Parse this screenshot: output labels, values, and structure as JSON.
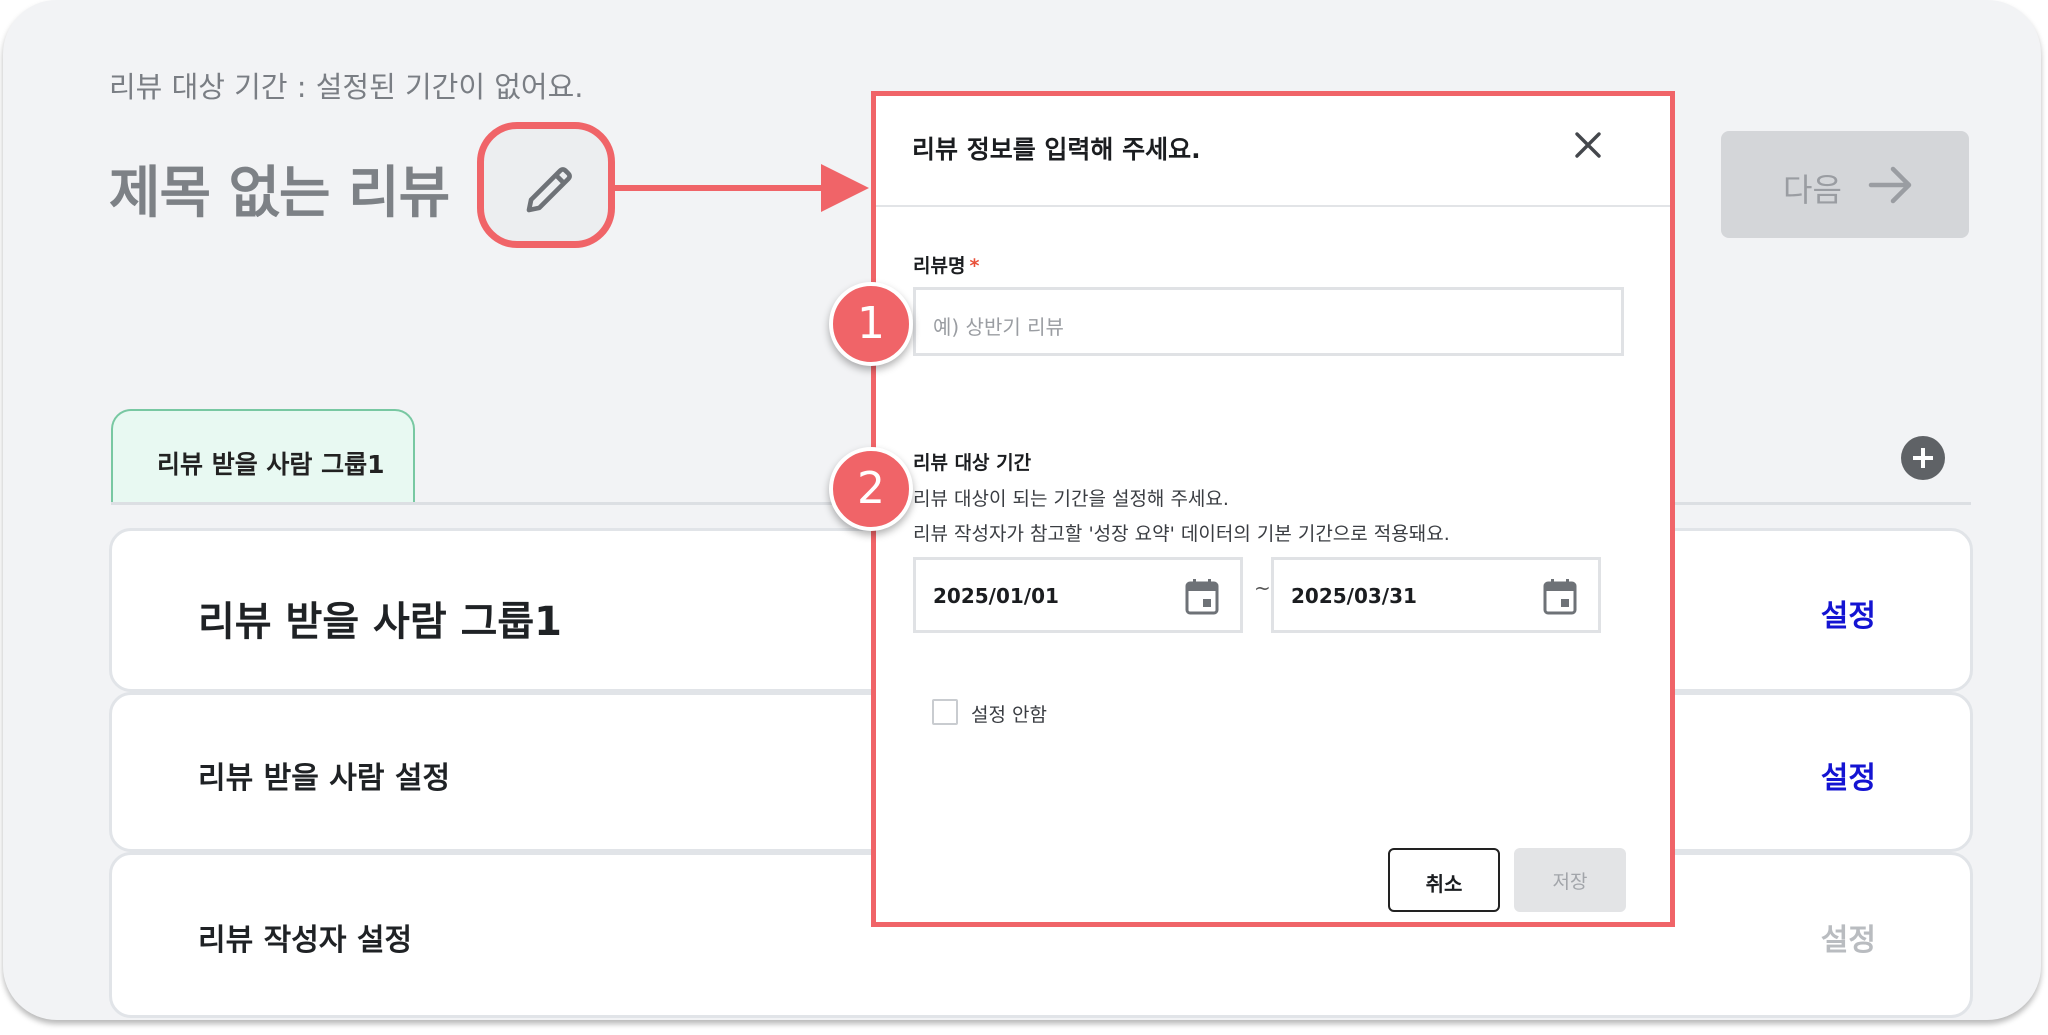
{
  "page": {
    "period_text": "리뷰 대상 기간 : 설정된 기간이 없어요.",
    "title": "제목 없는 리뷰",
    "next_label": "다음"
  },
  "tabs": [
    {
      "label": "리뷰 받을 사람 그룹1"
    }
  ],
  "cards": [
    {
      "title": "리뷰 받을 사람 그룹1",
      "action": "설정"
    },
    {
      "title": "리뷰 받을 사람 설정",
      "action": "설정"
    },
    {
      "title": "리뷰 작성자 설정",
      "action": "설정"
    }
  ],
  "modal": {
    "title": "리뷰 정보를 입력해 주세요.",
    "name_label": "리뷰명",
    "required_mark": "*",
    "name_placeholder": "예) 상반기 리뷰",
    "period_label": "리뷰 대상 기간",
    "period_desc_1": "리뷰 대상이 되는 기간을 설정해 주세요.",
    "period_desc_2": "리뷰 작성자가 참고할 '성장 요약' 데이터의 기본 기간으로 적용돼요.",
    "start_date": "2025/01/01",
    "range_sep": "~",
    "end_date": "2025/03/31",
    "no_period_label": "설정 안함",
    "cancel_label": "취소",
    "save_label": "저장"
  },
  "annotations": {
    "badge1": "1",
    "badge2": "2"
  },
  "colors": {
    "highlight": "#f06468",
    "link_blue": "#1414d2",
    "disabled_gray": "#b9bcc0",
    "tab_bg": "#e8f9f2"
  }
}
